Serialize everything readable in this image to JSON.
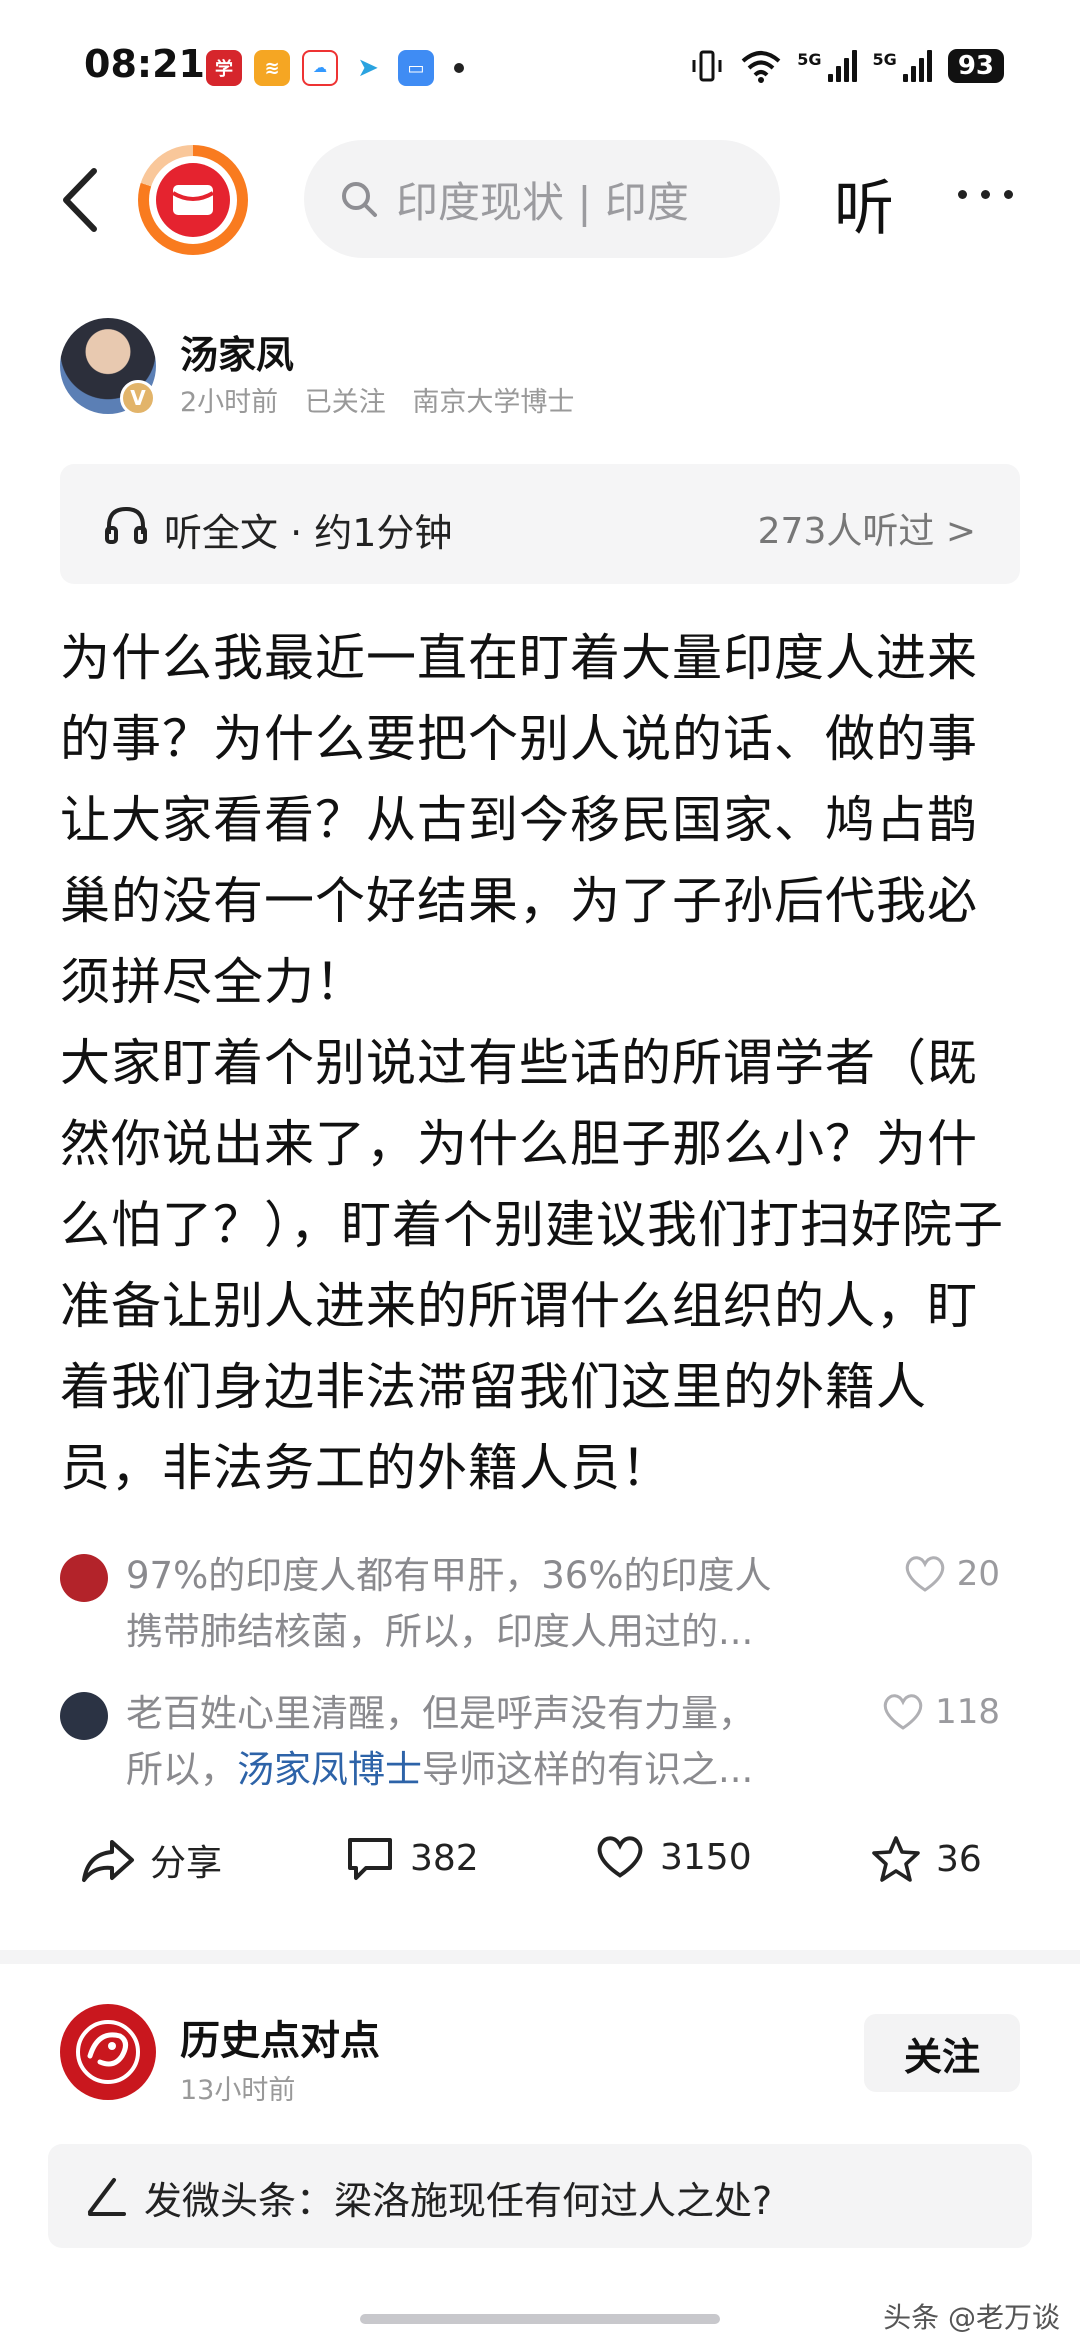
{
  "status_bar": {
    "time": "08:21",
    "signal_1": "5G",
    "signal_2": "5G",
    "battery": "93"
  },
  "top_nav": {
    "search_placeholder": "印度现状 | 印度",
    "listen_label": "听"
  },
  "author": {
    "name": "汤家凤",
    "badge": "V",
    "time": "2小时前",
    "follow_state": "已关注",
    "title": "南京大学博士"
  },
  "listen_bar": {
    "label": "听全文 · 约1分钟",
    "count": "273人听过",
    "chevron": ">"
  },
  "article": {
    "paragraphs": [
      "为什么我最近一直在盯着大量印度人进来的事？为什么要把个别人说的话、做的事让大家看看？从古到今移民国家、鸠占鹊巢的没有一个好结果，为了子孙后代我必须拼尽全力！",
      "大家盯着个别说过有些话的所谓学者（既然你说出来了，为什么胆子那么小？为什么怕了？），盯着个别建议我们打扫好院子准备让别人进来的所谓什么组织的人，盯着我们身边非法滞留我们这里的外籍人员，非法务工的外籍人员！"
    ]
  },
  "comments": [
    {
      "line1": "97%的印度人都有甲肝，36%的印度人",
      "line2": "携带肺结核菌，所以，印度人用过的...",
      "likes": "20",
      "avatar_color": "#b3232a"
    },
    {
      "line1": "老百姓心里清醒，但是呼声没有力量，",
      "line2_pre": "所以，",
      "line2_link": "汤家凤博士",
      "line2_post": "导师这样的有识之...",
      "likes": "118",
      "avatar_color": "#2b3344"
    }
  ],
  "actions": {
    "share": "分享",
    "comments": "382",
    "likes": "3150",
    "favorites": "36"
  },
  "next_post": {
    "author": "历史点对点",
    "time": "13小时前",
    "follow": "关注"
  },
  "post_bar": {
    "text": "发微头条：梁洛施现任有何过人之处?"
  },
  "watermark": "头条 @老万谈",
  "colors": {
    "brand_red": "#e5232f",
    "brand_orange": "#f97b1f",
    "link_blue": "#2d63a8"
  }
}
